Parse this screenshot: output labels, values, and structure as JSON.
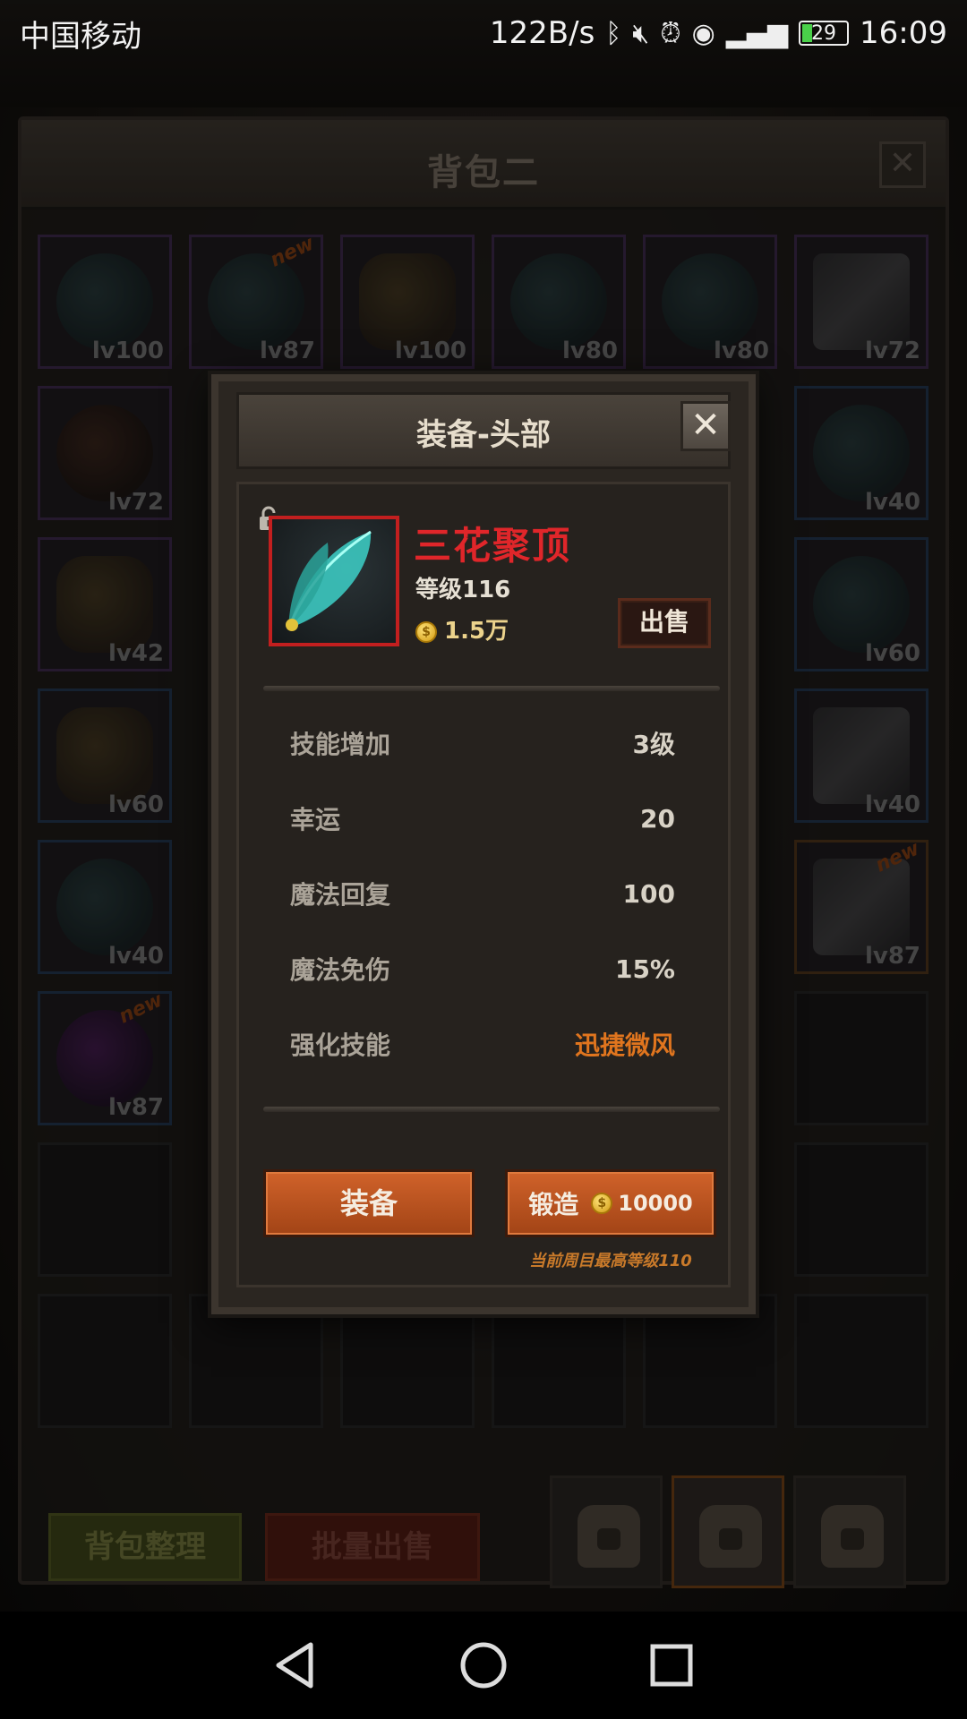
{
  "status_bar": {
    "carrier": "中国移动",
    "net_speed": "122B/s",
    "battery": "29",
    "time": "16:09"
  },
  "bag": {
    "title": "背包二",
    "close": "✕",
    "slots": [
      {
        "lv": "lv100"
      },
      {
        "lv": "lv87",
        "tag": "new"
      },
      {
        "lv": "lv100"
      },
      {
        "lv": "lv80"
      },
      {
        "lv": "lv80"
      },
      {
        "lv": "lv72"
      },
      {
        "lv": "lv72"
      },
      {
        "lv": "lv40"
      },
      {
        "lv": "lv42"
      },
      {
        "lv": "lv60"
      },
      {
        "lv": "lv60"
      },
      {
        "lv": "lv40"
      },
      {
        "lv": "lv40"
      },
      {
        "lv": "lv87",
        "tag": "new"
      },
      {
        "lv": "lv87",
        "tag": "new"
      }
    ],
    "sort_label": "背包整理",
    "bulk_sell_label": "批量出售"
  },
  "modal": {
    "title": "装备-头部",
    "close": "✕",
    "item": {
      "name": "三花聚顶",
      "level": "等级116",
      "price": "1.5万",
      "sell_label": "出售"
    },
    "stats": [
      {
        "label": "技能增加",
        "value": "3级"
      },
      {
        "label": "幸运",
        "value": "20"
      },
      {
        "label": "魔法回复",
        "value": "100"
      },
      {
        "label": "魔法免伤",
        "value": "15%"
      },
      {
        "label": "强化技能",
        "value": "迅捷微风"
      }
    ],
    "equip_label": "装备",
    "forge_label": "锻造",
    "forge_cost": "10000",
    "forge_note": "当前周目最高等级110",
    "coin_symbol": "$"
  },
  "colors": {
    "rarity_red": "#c21f1f",
    "item_name": "#e0262a",
    "accent_orange": "#e0751e"
  }
}
